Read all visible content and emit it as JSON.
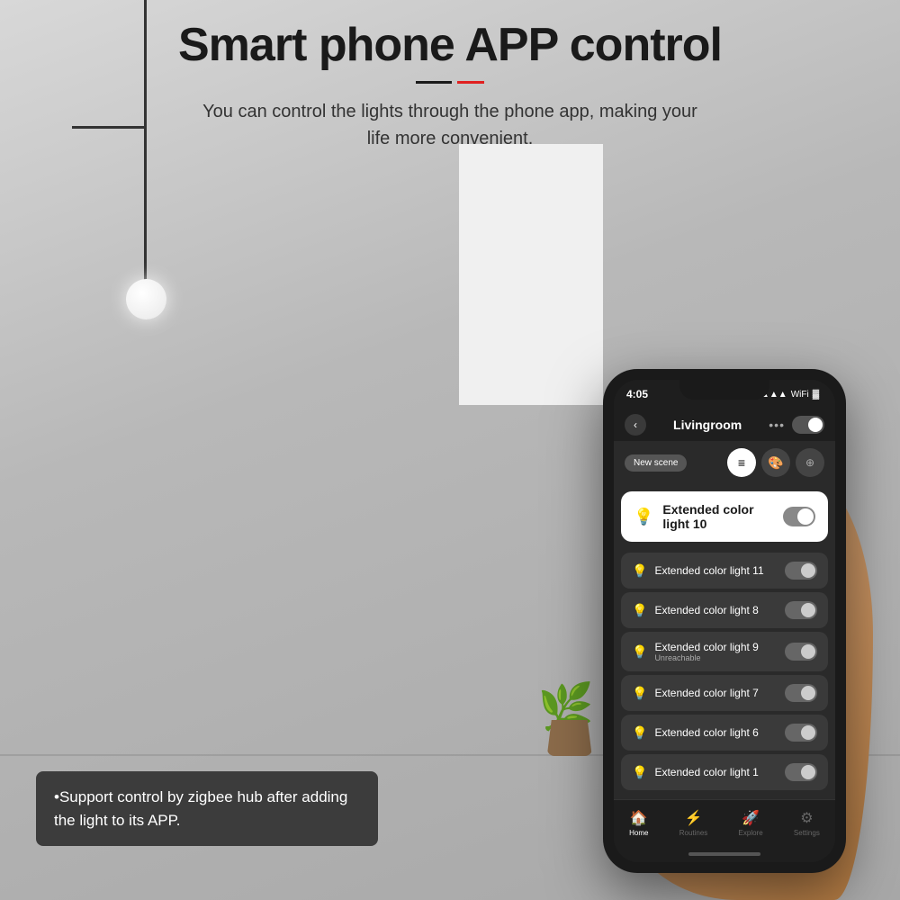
{
  "page": {
    "background_color": "#c0c0c0"
  },
  "hero": {
    "title": "Smart phone APP control",
    "underline_black": "black-line",
    "underline_red": "red-line",
    "subtitle_line1": "You can control the lights through the phone app, making your",
    "subtitle_line2": "life more convenient."
  },
  "info_box": {
    "text": "•Support control by zigbee hub after adding the light to its APP."
  },
  "phone": {
    "status_bar": {
      "time": "4:05",
      "signal": "📶",
      "wifi": "WiFi",
      "battery": "🔋"
    },
    "header": {
      "back_icon": "‹",
      "title": "Livingroom",
      "dots": "•••"
    },
    "toolbar": {
      "new_scene": "New scene",
      "list_icon": "≡",
      "palette_icon": "🎨",
      "color_icon": "⊕"
    },
    "featured_device": {
      "icon": "💡",
      "name": "Extended color light 10"
    },
    "devices": [
      {
        "icon": "💡",
        "name": "Extended color light 11",
        "status": ""
      },
      {
        "icon": "💡",
        "name": "Extended color light 8",
        "status": ""
      },
      {
        "icon": "💡",
        "name": "Extended color light 9",
        "status": "Unreachable"
      },
      {
        "icon": "💡",
        "name": "Extended color light 7",
        "status": ""
      },
      {
        "icon": "💡",
        "name": "Extended color light 6",
        "status": ""
      },
      {
        "icon": "💡",
        "name": "Extended color light 1",
        "status": ""
      }
    ],
    "bottom_nav": [
      {
        "icon": "🏠",
        "label": "Home",
        "active": true
      },
      {
        "icon": "⚡",
        "label": "Routines",
        "active": false
      },
      {
        "icon": "🚀",
        "label": "Explore",
        "active": false
      },
      {
        "icon": "⚙",
        "label": "Settings",
        "active": false
      }
    ]
  }
}
